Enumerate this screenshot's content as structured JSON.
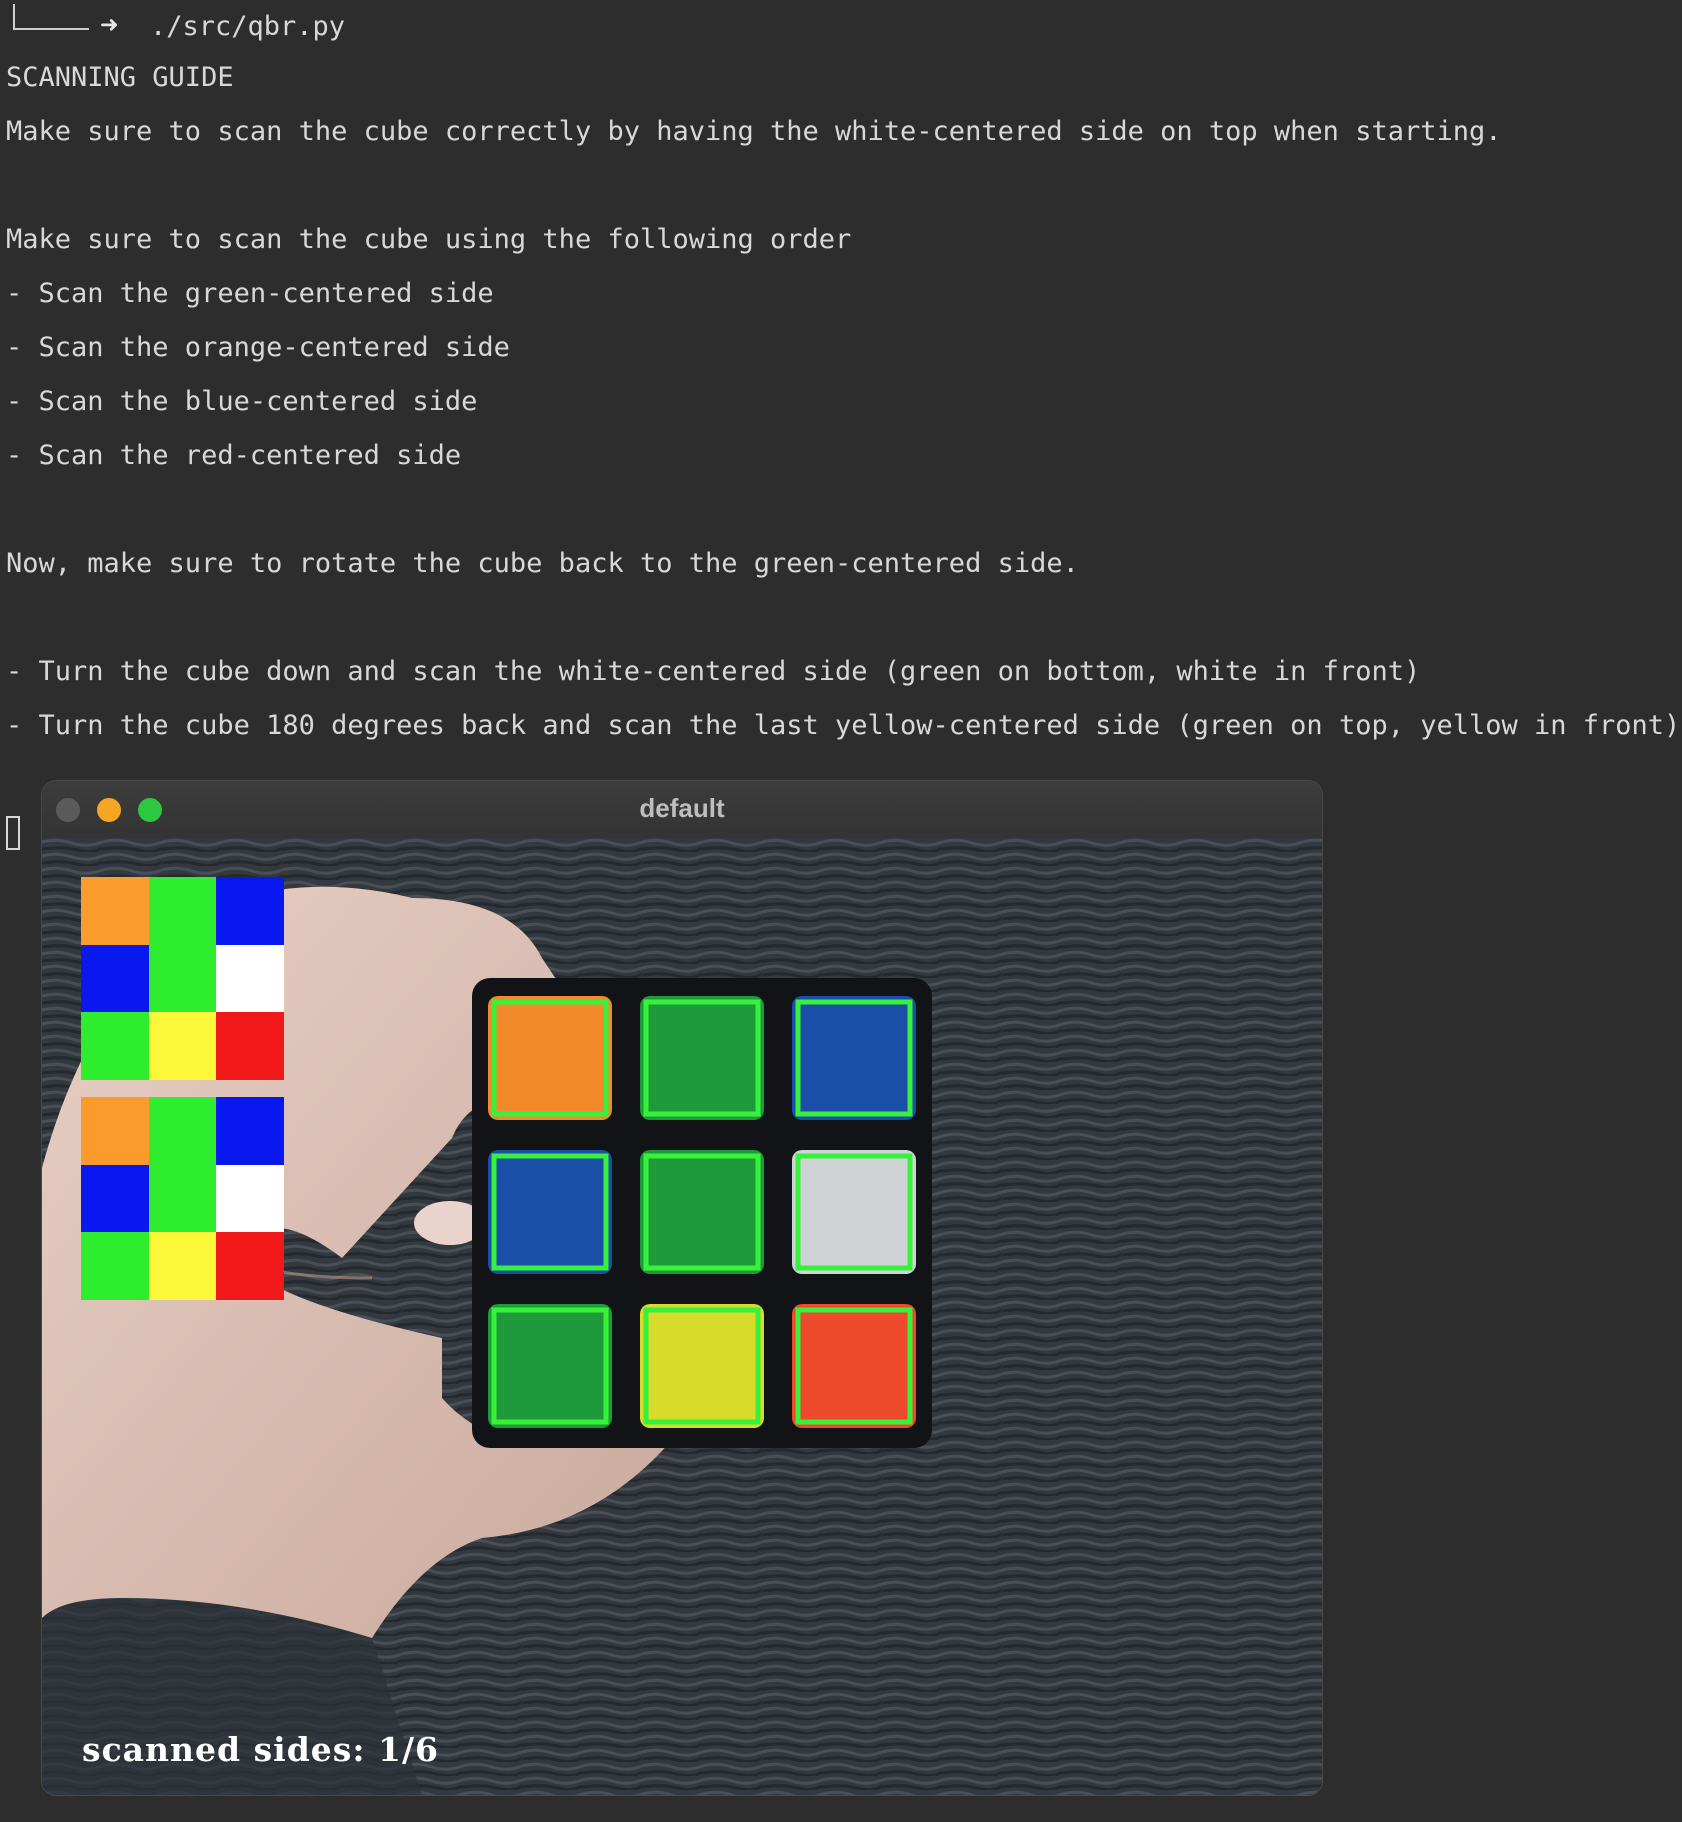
{
  "terminal": {
    "command": "./src/qbr.py",
    "heading": "SCANNING GUIDE",
    "intro": "Make sure to scan the cube correctly by having the white-centered side on top when starting.",
    "order_intro": "Make sure to scan the cube using the following order",
    "steps": [
      "- Scan the green-centered side",
      "- Scan the orange-centered side",
      "- Scan the blue-centered side",
      "- Scan the red-centered side"
    ],
    "rotate_note": "Now, make sure to rotate the cube back to the green-centered side.",
    "final_steps": [
      "- Turn the cube down and scan the white-centered side (green on bottom, white in front)",
      "- Turn the cube 180 degrees back and scan the last yellow-centered side (green on top, yellow in front)"
    ]
  },
  "window": {
    "title": "default",
    "status_text": "scanned sides: 1/6"
  },
  "preview_colors": {
    "orange": "#fb9b2b",
    "green": "#2eec2e",
    "blue": "#0a18f0",
    "white": "#ffffff",
    "yellow": "#fbf83a",
    "red": "#f01818"
  },
  "preview_top": [
    "orange",
    "green",
    "blue",
    "blue",
    "green",
    "white",
    "green",
    "yellow",
    "red"
  ],
  "preview_bottom": [
    "orange",
    "green",
    "blue",
    "blue",
    "green",
    "white",
    "green",
    "yellow",
    "red"
  ],
  "cube_stickers": [
    "orange",
    "green",
    "blue",
    "blue",
    "green",
    "white",
    "green",
    "yellow",
    "red"
  ],
  "sticker_colors": {
    "orange": "#f2892a",
    "green": "#1f9a3a",
    "blue": "#1a4fa8",
    "white": "#cfd3d6",
    "yellow": "#d9db2a",
    "red": "#ec4a2a"
  },
  "outline_color": "#37f23a"
}
